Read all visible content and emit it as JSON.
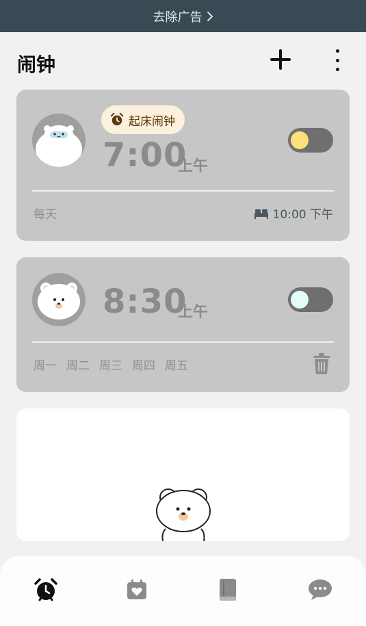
{
  "promo": {
    "label": "去除广告"
  },
  "header": {
    "title": "闹钟"
  },
  "alarms": [
    {
      "badge": "起床闹钟",
      "time": "7:00",
      "period": "上午",
      "repeat": "每天",
      "bedtime": "10:00 下午",
      "enabled": false,
      "knob_color": "#fde07a"
    },
    {
      "time": "8:30",
      "period": "上午",
      "days": [
        "周一",
        "周二",
        "周三",
        "周四",
        "周五"
      ],
      "enabled": false,
      "knob_color": "#e3fbfb"
    }
  ],
  "nav": [
    {
      "icon": "alarm-clock-icon",
      "active": true
    },
    {
      "icon": "calendar-heart-icon",
      "active": false
    },
    {
      "icon": "book-icon",
      "active": false
    },
    {
      "icon": "chat-bubble-icon",
      "active": false
    }
  ],
  "colors": {
    "topbar": "#3a4a54",
    "card": "#c5c6c5",
    "badge_bg": "#fdf0dc",
    "accent_yellow": "#fde07a"
  }
}
